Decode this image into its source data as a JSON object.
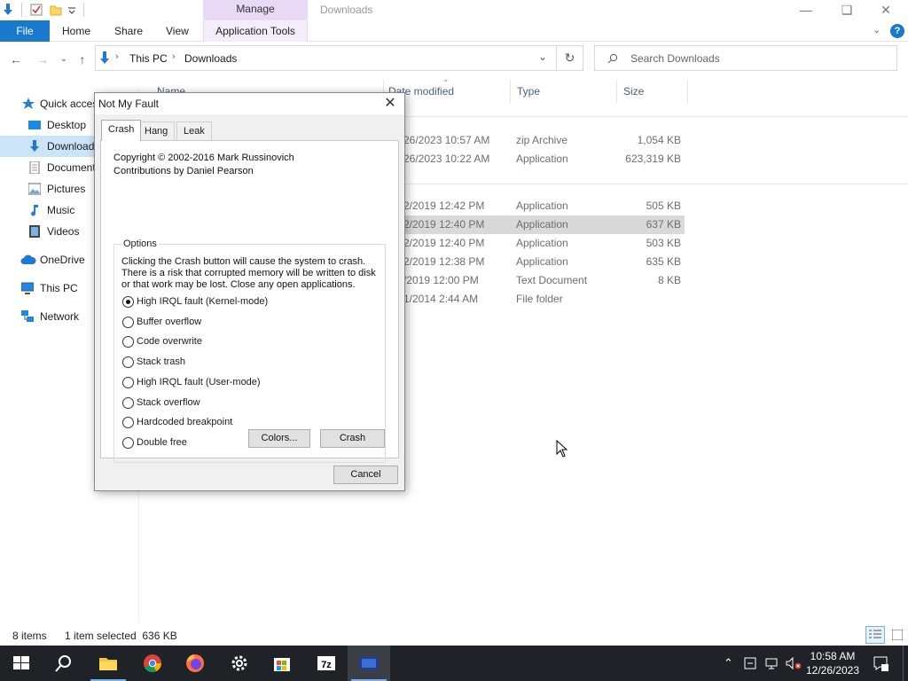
{
  "window": {
    "title": "Downloads",
    "manage_label": "Manage",
    "controls": [
      "minimize-icon",
      "restore-icon",
      "close-icon"
    ]
  },
  "ribbon": {
    "file": "File",
    "tabs": [
      "Home",
      "Share",
      "View",
      "Application Tools"
    ]
  },
  "address": {
    "path": [
      "This PC",
      "Downloads"
    ],
    "search_placeholder": "Search Downloads"
  },
  "nav": {
    "items": [
      {
        "label": "Quick access",
        "icon": "star-icon"
      },
      {
        "label": "Desktop",
        "icon": "desktop-icon"
      },
      {
        "label": "Downloads",
        "icon": "download-icon",
        "selected": true
      },
      {
        "label": "Documents",
        "icon": "document-icon"
      },
      {
        "label": "Pictures",
        "icon": "pictures-icon"
      },
      {
        "label": "Music",
        "icon": "music-icon"
      },
      {
        "label": "Videos",
        "icon": "videos-icon"
      },
      {
        "label": "OneDrive",
        "icon": "cloud-icon"
      },
      {
        "label": "This PC",
        "icon": "computer-icon"
      },
      {
        "label": "Network",
        "icon": "network-icon"
      }
    ]
  },
  "columns": {
    "name": "Name",
    "date": "Date modified",
    "type": "Type",
    "size": "Size"
  },
  "files": [
    {
      "date": "26/2023 10:57 AM",
      "type": "zip Archive",
      "size": "1,054 KB"
    },
    {
      "date": "26/2023 10:22 AM",
      "type": "Application",
      "size": "623,319 KB"
    },
    {
      "date": "2/2019 12:42 PM",
      "type": "Application",
      "size": "505 KB"
    },
    {
      "date": "2/2019 12:40 PM",
      "type": "Application",
      "size": "637 KB",
      "selected": true
    },
    {
      "date": "2/2019 12:40 PM",
      "type": "Application",
      "size": "503 KB"
    },
    {
      "date": "2/2019 12:38 PM",
      "type": "Application",
      "size": "635 KB"
    },
    {
      "date": "/2019 12:00 PM",
      "type": "Text Document",
      "size": "8 KB"
    },
    {
      "date": "1/2014 2:44 AM",
      "type": "File folder",
      "size": ""
    }
  ],
  "status": {
    "count": "8 items",
    "selected": "1 item selected  636 KB"
  },
  "dialog": {
    "title": "Not My Fault",
    "tabs": [
      "Crash",
      "Hang",
      "Leak"
    ],
    "copyright": "Copyright © 2002-2016 Mark Russinovich",
    "contributions": "Contributions by Daniel Pearson",
    "options_legend": "Options",
    "warning": [
      "Clicking the Crash button will cause the system to crash.",
      "There is a risk that corrupted memory will be written to disk",
      "or that work may be lost. Close any open applications."
    ],
    "options": [
      {
        "label": "High IRQL fault (Kernel-mode)",
        "checked": true
      },
      {
        "label": "Buffer overflow"
      },
      {
        "label": "Code overwrite"
      },
      {
        "label": "Stack trash"
      },
      {
        "label": "High IRQL fault (User-mode)"
      },
      {
        "label": "Stack overflow"
      },
      {
        "label": "Hardcoded breakpoint"
      },
      {
        "label": "Double free"
      }
    ],
    "colors_button": "Colors...",
    "crash_button": "Crash",
    "cancel_button": "Cancel"
  },
  "taskbar": {
    "icons": [
      "windows-start-icon",
      "search-icon",
      "file-explorer-icon",
      "chrome-icon",
      "firefox-icon",
      "settings-icon",
      "store-icon",
      "7zip-icon",
      "notmyfault-icon"
    ],
    "time": "10:58 AM",
    "date": "12/26/2023"
  },
  "colors": {
    "accent": "#1979ca",
    "manage_tab": "#e8d9f5",
    "taskbar": "#1f2226",
    "selection": "#cce4f7"
  }
}
